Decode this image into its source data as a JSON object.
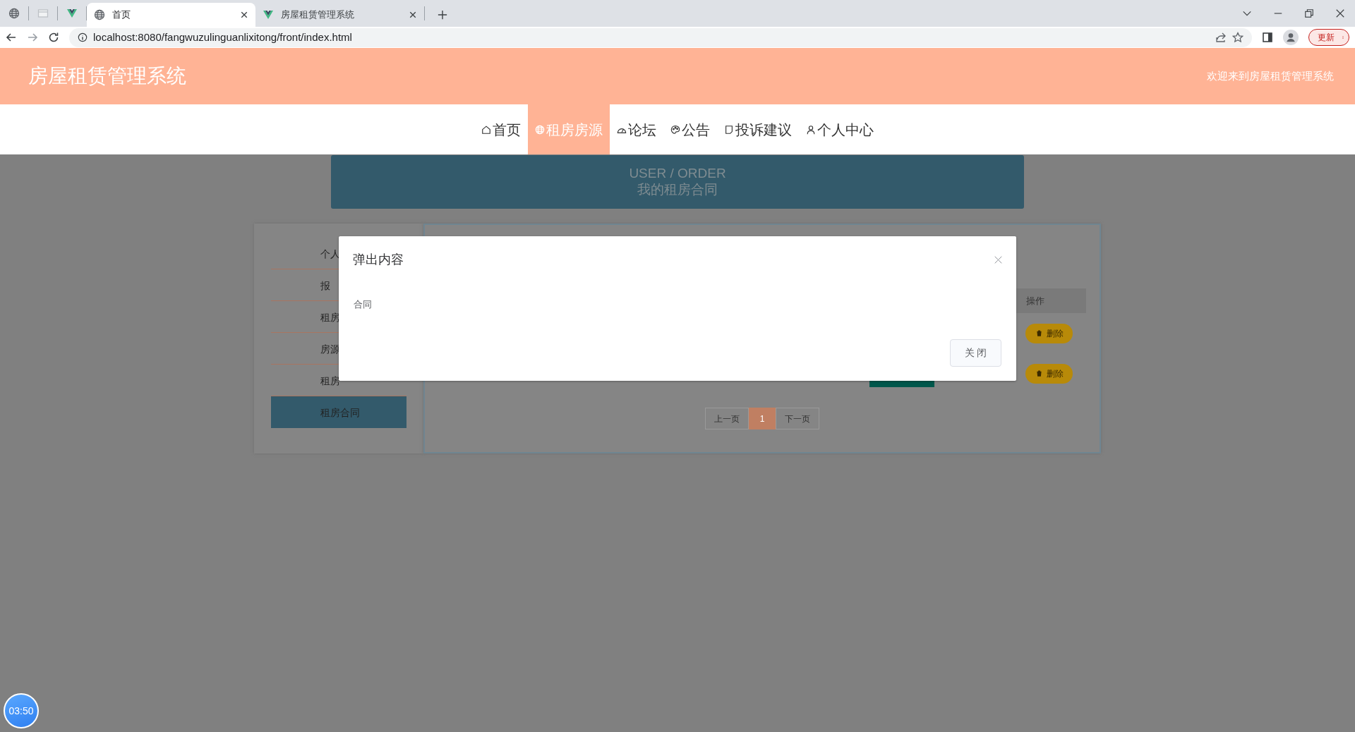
{
  "browser": {
    "pinned_tabs": [
      {
        "kind": "globe"
      },
      {
        "kind": "sheet"
      },
      {
        "kind": "vue"
      }
    ],
    "tabs": [
      {
        "title": "首页",
        "kind": "globe",
        "selected": true
      },
      {
        "title": "房屋租赁管理系统",
        "kind": "vue",
        "selected": false
      }
    ],
    "url": "localhost:8080/fangwuzulinguanlixitong/front/index.html",
    "update_button": "更新"
  },
  "header": {
    "title": "房屋租赁管理系统",
    "welcome": "欢迎来到房屋租赁管理系统"
  },
  "nav": [
    {
      "label": "首页",
      "kind": "home",
      "selected": false
    },
    {
      "label": "租房房源",
      "kind": "globe",
      "selected": true
    },
    {
      "label": "论坛",
      "kind": "gauge",
      "selected": false
    },
    {
      "label": "公告",
      "kind": "palette",
      "selected": false
    },
    {
      "label": "投诉建议",
      "kind": "note",
      "selected": false
    },
    {
      "label": "个人中心",
      "kind": "user",
      "selected": false
    }
  ],
  "banner": {
    "title": "USER / ORDER",
    "subtitle": "我的租房合同"
  },
  "sidebar": [
    {
      "label": "个人",
      "selected": false
    },
    {
      "label": "报",
      "selected": false
    },
    {
      "label": "租房",
      "selected": false
    },
    {
      "label": "房源",
      "selected": false
    },
    {
      "label": "租房",
      "selected": false
    },
    {
      "label": "租房合同",
      "selected": true
    }
  ],
  "table": {
    "columns": [
      "操作"
    ],
    "rows": [
      {
        "action": "删除"
      },
      {
        "action": "删除"
      }
    ]
  },
  "pagination": {
    "prev": "上一页",
    "pages": [
      {
        "label": "1",
        "selected": true
      }
    ],
    "next": "下一页"
  },
  "modal": {
    "title": "弹出内容",
    "body": "合同",
    "close_button": "关 闭"
  },
  "timer": "03:50"
}
